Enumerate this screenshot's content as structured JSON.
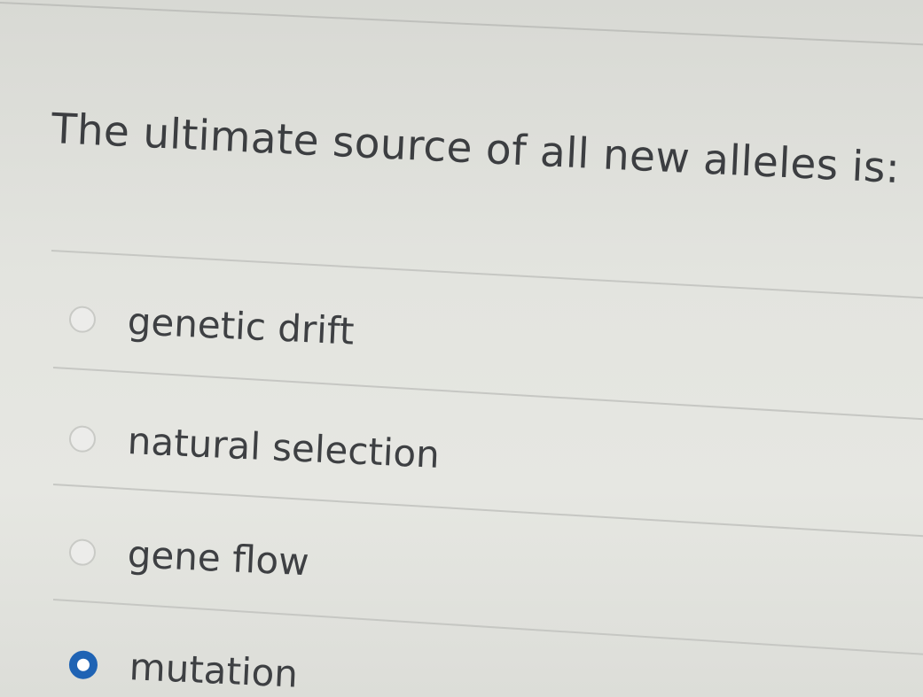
{
  "question": {
    "text": "The ultimate source of all new alleles is:"
  },
  "options": [
    {
      "label": "genetic drift",
      "selected": false
    },
    {
      "label": "natural selection",
      "selected": false
    },
    {
      "label": "gene flow",
      "selected": false
    },
    {
      "label": "mutation",
      "selected": true
    }
  ],
  "colors": {
    "selected_radio": "#1f63b4",
    "text": "#3e4043",
    "background": "#e3e4df"
  }
}
